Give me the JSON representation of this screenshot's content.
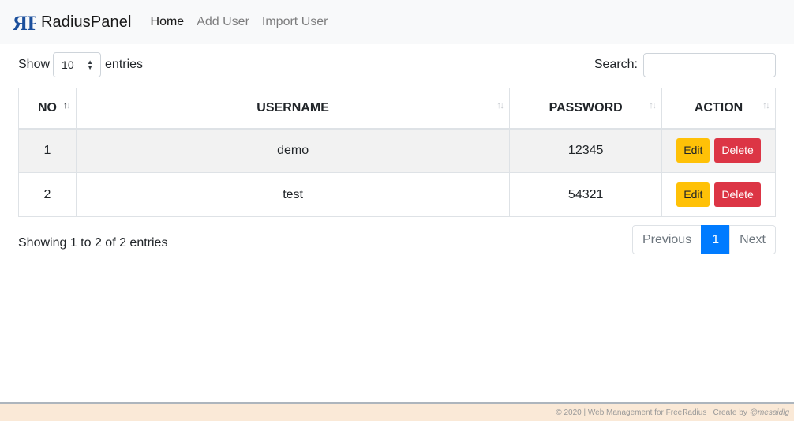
{
  "navbar": {
    "brand_text": "RadiusPanel",
    "links": [
      {
        "label": "Home",
        "active": true
      },
      {
        "label": "Add User",
        "active": false
      },
      {
        "label": "Import User",
        "active": false
      }
    ],
    "brand_color": "#1b4f9c"
  },
  "controls": {
    "show_label": "Show",
    "page_length_value": "10",
    "entries_label": "entries",
    "search_label": "Search:",
    "search_value": ""
  },
  "table": {
    "columns": [
      "NO",
      "USERNAME",
      "PASSWORD",
      "ACTION"
    ],
    "rows": [
      {
        "no": "1",
        "username": "demo",
        "password": "12345",
        "edit_label": "Edit",
        "delete_label": "Delete"
      },
      {
        "no": "2",
        "username": "test",
        "password": "54321",
        "edit_label": "Edit",
        "delete_label": "Delete"
      }
    ]
  },
  "info_text": "Showing 1 to 2 of 2 entries",
  "pagination": {
    "previous_label": "Previous",
    "current_page": "1",
    "next_label": "Next"
  },
  "footer": {
    "text": "© 2020 | Web Management for FreeRadius | Create by",
    "author": "@mesaidlg"
  },
  "colors": {
    "edit": "#ffc107",
    "delete": "#dc3545",
    "active_page": "#007bff",
    "footer_bg": "#fae9d7"
  }
}
